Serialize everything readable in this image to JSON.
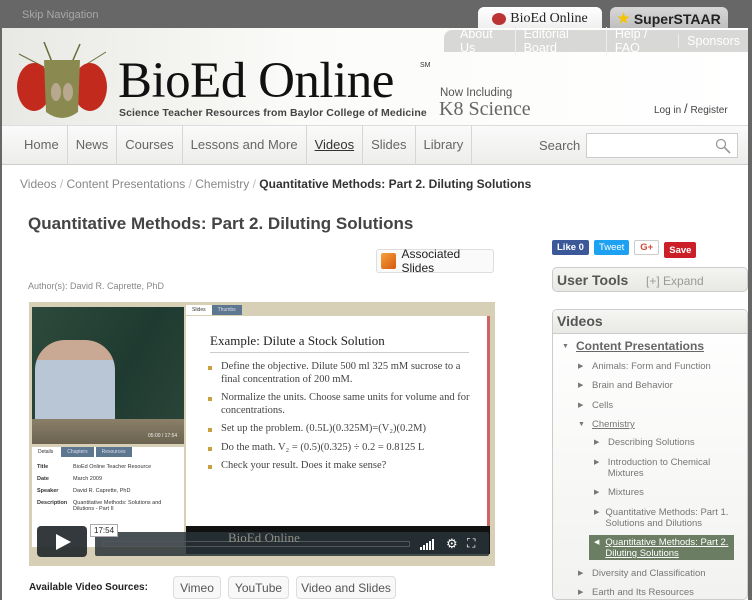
{
  "topbar": {
    "skip": "Skip Navigation",
    "tabs": [
      "BioEd Online",
      "SuperSTAAR"
    ]
  },
  "header": {
    "links": [
      "About Us",
      "Editorial Board",
      "Help / FAQ",
      "Sponsors"
    ],
    "logo": "BioEd Online",
    "sm": "SM",
    "tagline": "Science Teacher Resources from Baylor College of Medicine",
    "now_including": "Now Including",
    "k8": "K8 Science",
    "login": "Log in",
    "sep": "/",
    "register": "Register"
  },
  "nav": {
    "items": [
      "Home",
      "News",
      "Courses",
      "Lessons and More",
      "Videos",
      "Slides",
      "Library"
    ],
    "active": "Videos",
    "search_label": "Search",
    "search_value": ""
  },
  "breadcrumb": {
    "items": [
      "Videos",
      "Content Presentations",
      "Chemistry"
    ],
    "sep": " / ",
    "current": "Quantitative Methods: Part 2. Diluting Solutions"
  },
  "main": {
    "title": "Quantitative Methods: Part 2. Diluting Solutions",
    "assoc": "Associated Slides",
    "author": "Author(s): David R. Caprette, PhD"
  },
  "video": {
    "ctrl_time": "05:00 / 17:54",
    "detail_tabs": [
      "Details",
      "Chapters",
      "Resources"
    ],
    "details": [
      [
        "Title",
        "BioEd Online Teacher Resource"
      ],
      [
        "Date",
        "March 2009"
      ],
      [
        "Speaker",
        "David R. Caprette, PhD"
      ],
      [
        "Description",
        "Quantitative Methods: Solutions and Dilutions - Part II"
      ]
    ],
    "slide_tabs": [
      "Slides",
      "Thumbs"
    ],
    "slide_title": "Example:  Dilute a Stock Solution",
    "bullets": [
      "Define the objective.  Dilute 500 ml 325 mM sucrose to a final concentration of 200 mM.",
      "Normalize the units.  Choose same units for volume and for concentrations.",
      "Set up the problem.  (0.5L)(0.325M)=(V₂)(0.2M)",
      "Do the math. V₂ = (0.5)(0.325) ÷ 0.2 = 0.8125 L",
      "Check your result. Does it make sense?"
    ],
    "slide_footer": "BioEd Online",
    "duration": "17:54"
  },
  "sources": {
    "label": "Available Video Sources:",
    "items": [
      "Vimeo",
      "YouTube",
      "Video and Slides"
    ]
  },
  "social": {
    "like": "Like 0",
    "tweet": "Tweet",
    "gplus": "G+",
    "save": "Save"
  },
  "user_tools": {
    "title": "User Tools",
    "expand": "[+] Expand"
  },
  "videos_nav": {
    "title": "Videos",
    "root": "Content Presentations",
    "items": [
      "Animals: Form and Function",
      "Brain and Behavior",
      "Cells",
      "Chemistry"
    ],
    "chem": [
      "Describing Solutions",
      "Introduction to Chemical Mixtures",
      "Mixtures",
      "Quantitative Methods: Part 1. Solutions and Dilutions",
      "Quantitative Methods: Part 2. Diluting Solutions"
    ],
    "after": [
      "Diversity and Classification",
      "Earth and Its Resources"
    ]
  },
  "colors": {
    "accent": "#6b7d62",
    "topbar": "#676767"
  }
}
